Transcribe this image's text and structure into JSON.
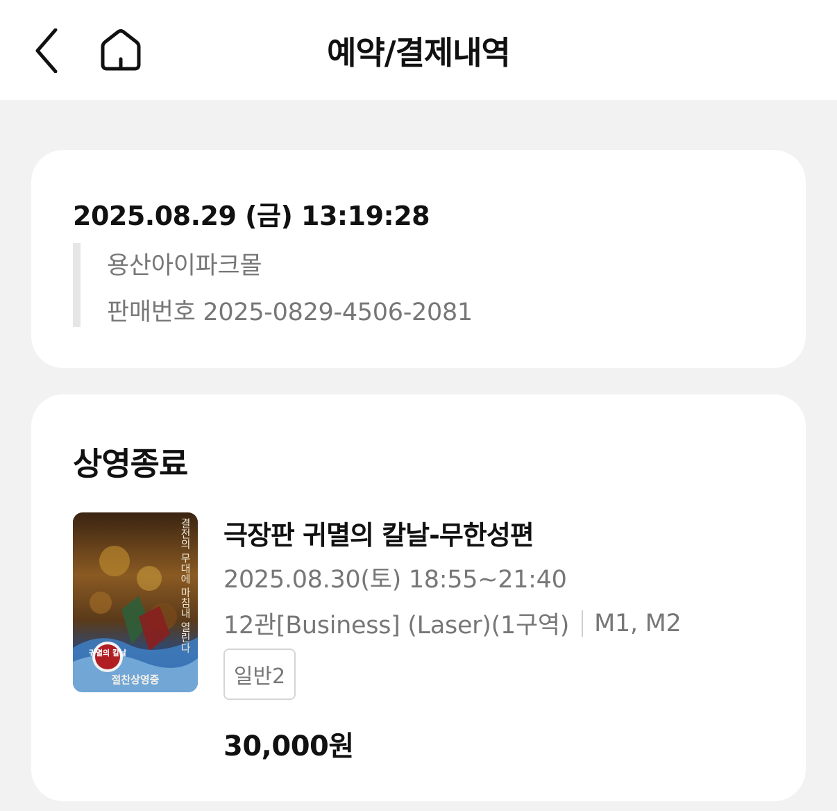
{
  "header": {
    "title": "예약/결제내역",
    "back_icon": "chevron-left-icon",
    "home_icon": "home-icon"
  },
  "order": {
    "datetime": "2025.08.29 (금) 13:19:28",
    "cinema": "용산아이파크몰",
    "sales_number": "판매번호 2025-0829-4506-2081"
  },
  "ticket": {
    "status": "상영종료",
    "movie_title": "극장판 귀멸의 칼날-무한성편",
    "showtime": "2025.08.30(토) 18:55~21:40",
    "theater": "12관[Business] (Laser)(1구역)",
    "seats": "M1, M2",
    "ticket_type": "일반2",
    "price": "30,000원",
    "poster": {
      "caption_vertical": "결전의 무대에 마침내 열린다",
      "logo_text": "귀멸의 칼날",
      "bottom_text": "절찬상영중"
    }
  }
}
